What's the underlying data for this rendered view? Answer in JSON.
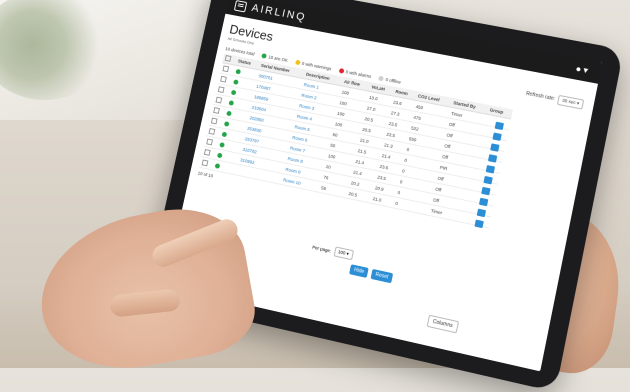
{
  "app": {
    "brand": "AIRLINQ",
    "page_title": "Devices",
    "subtitle": "All Schools One"
  },
  "legend": {
    "total": "10 devices total",
    "ok": "10 are OK",
    "warn": "0 with warnings",
    "alarm": "0 with alarms",
    "offline": "0 offline"
  },
  "refresh": {
    "label": "Refresh rate:",
    "value": "30 sec"
  },
  "table": {
    "headers": [
      "Status",
      "Serial Number",
      "Description",
      "Air flow",
      "VoLaH",
      "Room",
      "CO2 Level",
      "Started By",
      "Group"
    ],
    "rows": [
      {
        "serial": "000751",
        "desc": "Room 1",
        "air": "100",
        "vol": "10.0",
        "room": "23.6",
        "co2": "450",
        "by": "Timer"
      },
      {
        "serial": "170487",
        "desc": "Room 2",
        "air": "100",
        "vol": "27.0",
        "room": "27.3",
        "co2": "475",
        "by": "Off"
      },
      {
        "serial": "189859",
        "desc": "Room 3",
        "air": "100",
        "vol": "20.5",
        "room": "23.5",
        "co2": "522",
        "by": "Off"
      },
      {
        "serial": "210604",
        "desc": "Room 4",
        "air": "100",
        "vol": "20.5",
        "room": "23.5",
        "co2": "550",
        "by": "Off"
      },
      {
        "serial": "202850",
        "desc": "Room 5",
        "air": "60",
        "vol": "21.0",
        "room": "21.3",
        "co2": "0",
        "by": "Off"
      },
      {
        "serial": "253830",
        "desc": "Room 6",
        "air": "50",
        "vol": "21.5",
        "room": "21.4",
        "co2": "0",
        "by": "PIR"
      },
      {
        "serial": "253797",
        "desc": "Room 7",
        "air": "100",
        "vol": "21.4",
        "room": "23.6",
        "co2": "0",
        "by": "Off"
      },
      {
        "serial": "310792",
        "desc": "Room 8",
        "air": "10",
        "vol": "21.4",
        "room": "23.5",
        "co2": "0",
        "by": "Off"
      },
      {
        "serial": "310992",
        "desc": "Room 9",
        "air": "76",
        "vol": "20.2",
        "room": "20.9",
        "co2": "0",
        "by": "Off"
      },
      {
        "serial": "",
        "desc": "Room 10",
        "air": "56",
        "vol": "20.5",
        "room": "21.0",
        "co2": "0",
        "by": "Timer"
      }
    ]
  },
  "footer": {
    "count": "10 of 10",
    "per_page_label": "Per page:",
    "per_page": "100"
  },
  "buttons": {
    "hide": "Hide",
    "reset": "Reset",
    "columns": "Columns"
  },
  "colors": {
    "ok": "#22a447",
    "warn": "#f2c11b",
    "alarm": "#e0242a",
    "offline": "#cfcfcf",
    "accent": "#2c8fd6"
  }
}
